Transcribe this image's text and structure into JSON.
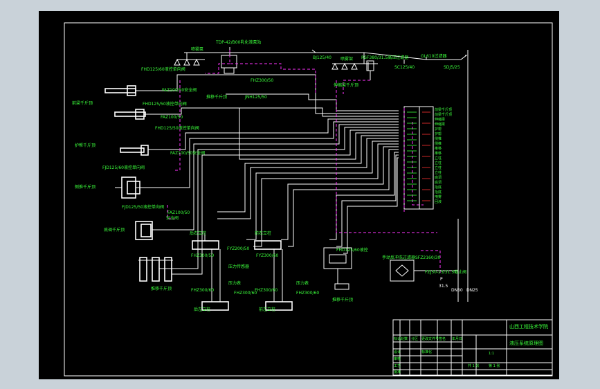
{
  "labels": {
    "watering_pump": "喷雾泵",
    "pump_unit": "TDP-42/B00乳化液泵站",
    "valve_a": "BJ125/40",
    "nozzle_set": "喷雾架",
    "filter": "RSF380/31.5高压过滤器",
    "unit_right": "GL610过滤器",
    "valve_b": "SC125/40",
    "valve_c": "BJ125/40",
    "valve_d": "SDJ5/25",
    "rv_top": "FHD125/60液控单向阀",
    "safe_top": "FAZ100/50安全阀",
    "jack_raise": "前梁千斤顶",
    "jack_fpu": "推移千斤顶",
    "fhj_mid": "FHZ300/50",
    "safe_mid": "JNH125/50",
    "jack_side": "伸缩梁千斤顶",
    "rv_mid": "FHD125/50液控单向阀",
    "safe_mid2": "FAZ100/50",
    "relief_1": "FHD125/50液控单向阀",
    "jack_protect": "护帮千斤顶",
    "safe_mid3": "FAZ100/50安全阀",
    "rv_left": "FJD125/60液控单向阀",
    "jack_balance": "侧推千斤顶",
    "rv_low": "FJD125/50液控单向阀",
    "safe_low": "FAZ100/50",
    "safe_word": "安全阀",
    "jack_bottom": "底调千斤顶",
    "jack_leg": "推移千斤顶",
    "front_col_l": "后右立柱",
    "front_col_r": "前右立柱",
    "pipe_v1": "FYZ200/50",
    "pipe_v2": "FYZ300/60",
    "check_1": "压力表",
    "check_2": "压力表",
    "pres_1": "压力传感器",
    "v_bl": "FHZ300/60",
    "v_br": "FHZ300/60",
    "col_bl": "后左立柱",
    "col_br": "前左立柱",
    "small1": "FHZ300/50",
    "small2": "FHZ300/50",
    "small3": "FHZ300/60",
    "small4": "FHZ300/60",
    "box_valve": "FHD125/60液控",
    "jack_push": "推移千斤顶",
    "manual_note": "手动反冲洗过滤器SFZ2160/30",
    "manual_v": "FZJ50-25/31.5截止阀",
    "dn_left": "DN50",
    "dn_right": "DN25",
    "p_1": "P",
    "p_2": "31.5",
    "valve_top_label": "FHZ300/50",
    "nozzle_label": "喷雾",
    "rk_list": [
      "前梁千斤顶",
      "前梁千斤顶",
      "伸缩梁",
      "伸缩梁",
      "护帮",
      "护帮",
      "侧推",
      "侧推",
      "推移",
      "推移",
      "立柱",
      "立柱",
      "立柱",
      "立柱",
      "底调",
      "底调",
      "抬底",
      "抬底",
      "喷雾",
      "回液"
    ]
  },
  "title_block": {
    "school": "山西工程技术学院",
    "drawing_name": "液压系统原理图",
    "scale": "1:1",
    "sheet": "共 1 张",
    "sheet_no": "第 1 张",
    "cells": [
      "标记",
      "处数",
      "分区",
      "更改文件号",
      "签名",
      "年月日",
      "设计",
      "审核",
      "工艺",
      "批准",
      "标准化"
    ]
  }
}
